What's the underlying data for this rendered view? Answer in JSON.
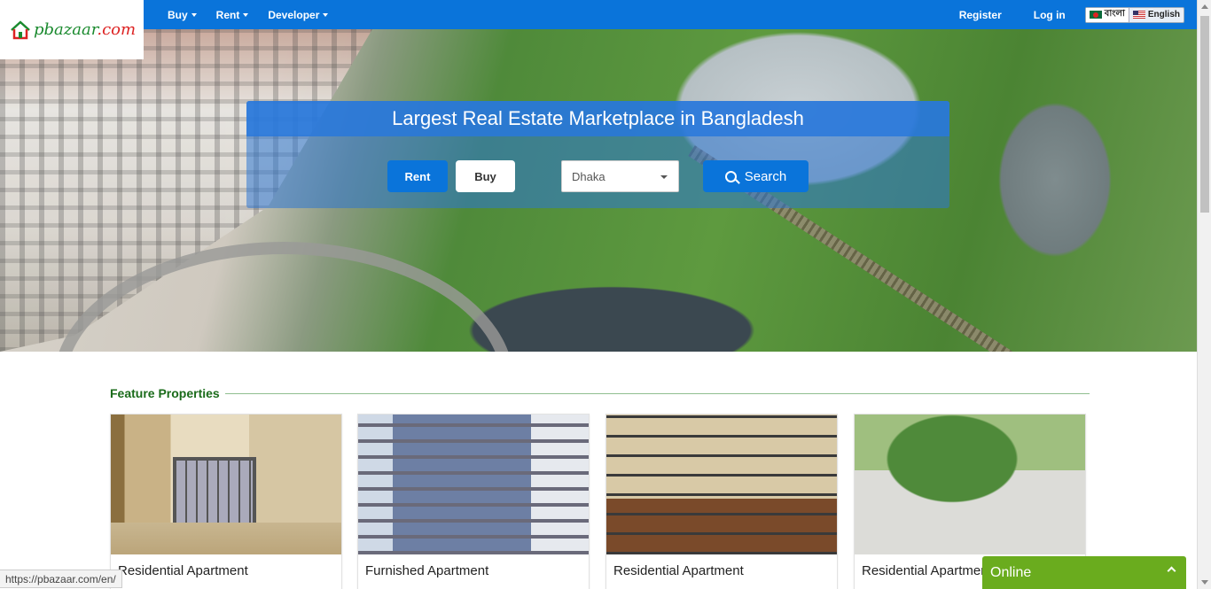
{
  "logo": {
    "text_main": "pbazaar",
    "text_dot": ".com"
  },
  "nav": {
    "left": [
      {
        "label": "Buy"
      },
      {
        "label": "Rent"
      },
      {
        "label": "Developer"
      }
    ],
    "register": "Register",
    "login": "Log in",
    "lang_bn": "বাংলা",
    "lang_en": "English"
  },
  "hero": {
    "title": "Largest Real Estate Marketplace in Bangladesh",
    "rent_btn": "Rent",
    "buy_btn": "Buy",
    "city_selected": "Dhaka",
    "search_btn": "Search"
  },
  "featured": {
    "heading": "Feature Properties",
    "cards": [
      {
        "title": "Residential Apartment"
      },
      {
        "title": "Furnished Apartment"
      },
      {
        "title": "Residential Apartment"
      },
      {
        "title": "Residential Apartment"
      }
    ]
  },
  "status_url": "https://pbazaar.com/en/",
  "chat": {
    "label": "Online"
  },
  "colors": {
    "primary": "#0a74da",
    "accent_green": "#6aac1e",
    "heading_green": "#1a6b1a"
  }
}
